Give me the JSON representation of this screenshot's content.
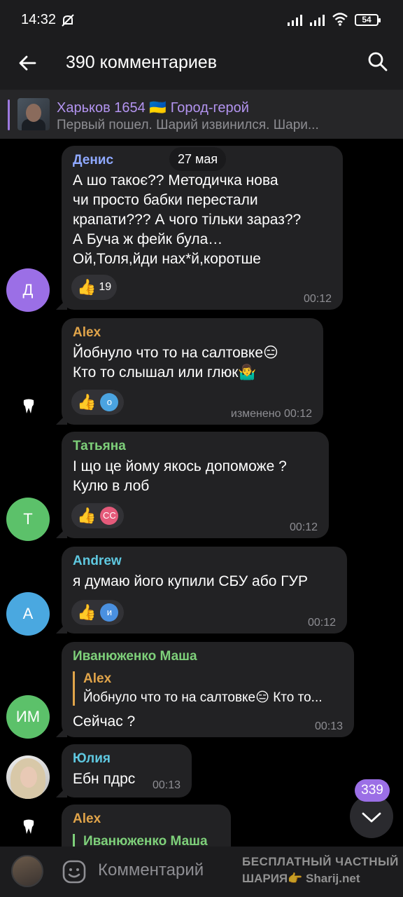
{
  "status_bar": {
    "time": "14:32",
    "battery": "54"
  },
  "header": {
    "title": "390 комментариев"
  },
  "pinned": {
    "title": "Харьков 1654 🇺🇦 Город-герой",
    "subtitle": "Первый пошел. Шарий извинился.   Шари..."
  },
  "date_pill": "27 мая",
  "messages": [
    {
      "author": "Денис",
      "author_color": "#8fa9ff",
      "avatar_letter": "Д",
      "avatar_color": "#9b6fe6",
      "text": "А шо такоє?? Методичка нова\nчи просто бабки перестали\nкрапати??? А чого тільки зараз??\nА Буча ж фейк була…\nОй,Толя,йди нах*й,коротше",
      "reaction_count": "19",
      "time": "00:12"
    },
    {
      "author": "Alex",
      "author_color": "#e0a44a",
      "text": "Йобнуло что то на салтовке😑\nКто то слышал или глюк🤷‍♂️",
      "reaction_avatar": "о",
      "reaction_avatar_color": "#4aa3e0",
      "time": "изменено 00:12"
    },
    {
      "author": "Татьяна",
      "author_color": "#7ed07a",
      "avatar_letter": "Т",
      "avatar_color": "#5cc16a",
      "text": "І що це йому якось допоможе ?\nКулю в лоб",
      "reaction_avatar": "СС",
      "reaction_avatar_color": "#e55a7a",
      "time": "00:12"
    },
    {
      "author": "Andrew",
      "author_color": "#5fc8e0",
      "avatar_letter": "А",
      "avatar_color": "#4aa8e0",
      "text": "я думаю його купили СБУ або ГУР",
      "reaction_avatar": "и",
      "reaction_avatar_color": "#4a90e0",
      "time": "00:12"
    },
    {
      "author": "Иванюженко Маша",
      "author_color": "#7ed07a",
      "avatar_letter": "ИМ",
      "avatar_color": "#5cc16a",
      "quote_author": "Alex",
      "quote_text": "Йобнуло что то на салтовке😑 Кто то...",
      "text": "Сейчас ?",
      "time": "00:13"
    },
    {
      "author": "Юлия",
      "author_color": "#5fc8e0",
      "text": "Ебн пдрс",
      "time": "00:13"
    },
    {
      "author": "Alex",
      "author_color": "#e0a44a",
      "quote_author": "Иванюженко Маша"
    }
  ],
  "scroll_badge": "339",
  "composer": {
    "placeholder": "Комментарий"
  },
  "watermark": {
    "line1": "БЕСПЛАТНЫЙ  ЧАСТНЫЙ",
    "line2": "ШАРИЯ👉 Sharij.net"
  },
  "colors": {
    "accent": "#9b6fe6",
    "bubble": "#222224",
    "background": "#000000"
  }
}
